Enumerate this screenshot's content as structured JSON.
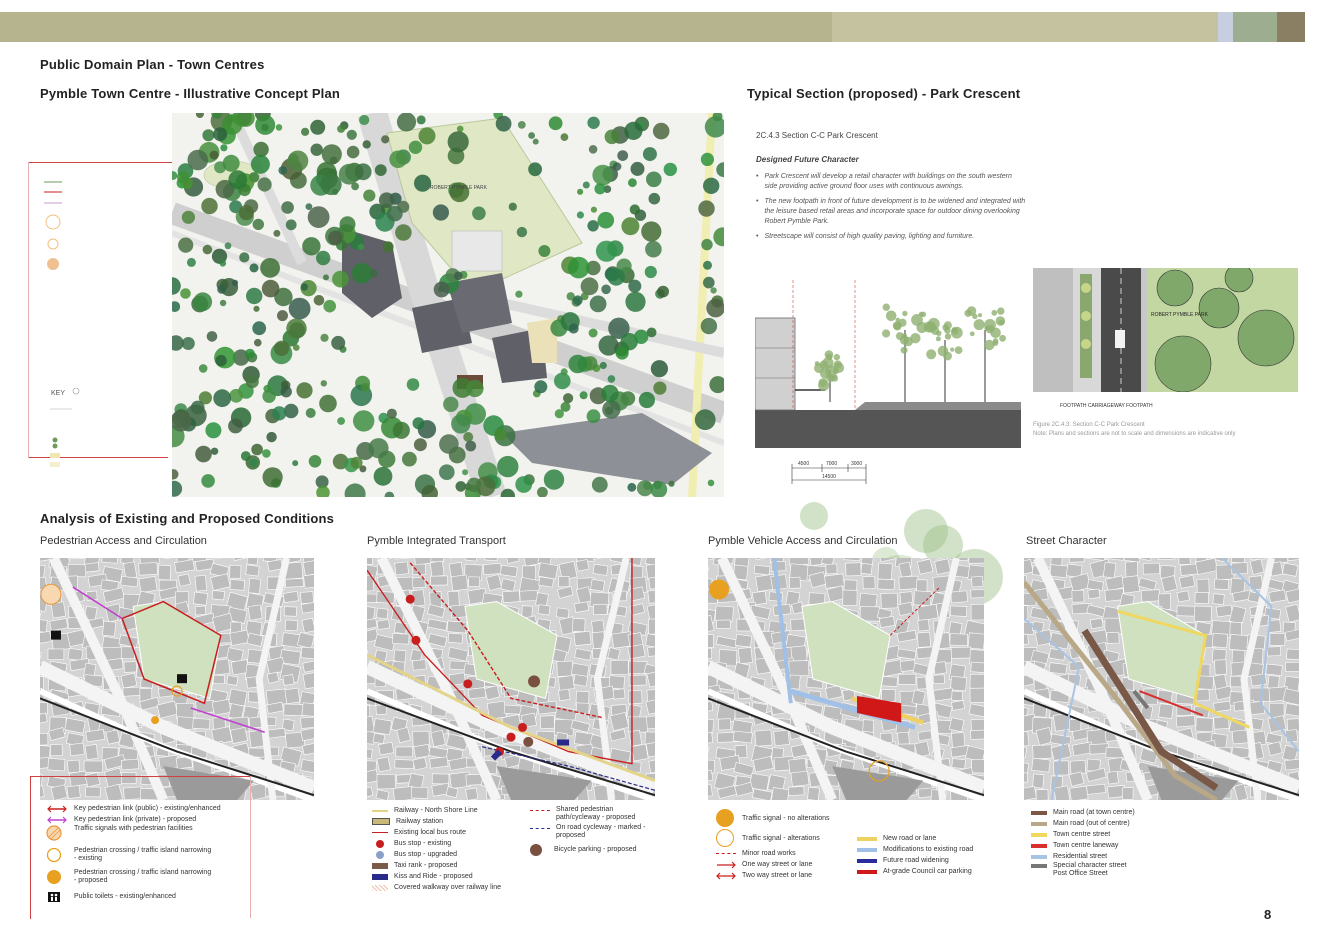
{
  "page": {
    "title": "Public Domain Plan - Town Centres",
    "page_number": "8",
    "colors": {
      "band_main": "#b5b48f",
      "band_light": "#c7cedf",
      "band_sage": "#9cae8f",
      "band_dark": "#8a7e63",
      "green": "#6e9a5a",
      "red": "#c81e1e"
    }
  },
  "concept_plan": {
    "title": "Pymble Town Centre - Illustrative Concept Plan",
    "park_label": "ROBERT PYMBLE PARK",
    "key_label": "KEY"
  },
  "section": {
    "title": "Typical Section (proposed) - Park Crescent",
    "heading": "2C.4.3 Section C-C Park Crescent",
    "subheading": "Designed Future Character",
    "bullets": [
      "Park Crescent will develop a retail character with buildings on the south western side providing active ground floor uses with continuous awnings.",
      "The new footpath in front of future development is to be widened and integrated with the leisure based retail areas and incorporate space for outdoor dining overlooking Robert Pymble Park.",
      "Streetscape will consist of high quality paving, lighting and furniture."
    ],
    "dims": [
      "4500",
      "7000",
      "3000"
    ],
    "total_dim": "14500",
    "plan_park_label": "ROBERT PYMBLE PARK",
    "plan_bottom_label": "FOOTPATH   CARRIAGEWAY   FOOTPATH",
    "figure_caption": "Figure 2C.4.3: Section C-C Park Crescent",
    "figure_note": "Note: Plans and sections are not to scale and dimensions are indicative only"
  },
  "analysis": {
    "title": "Analysis of Existing and Proposed Conditions",
    "panels": [
      {
        "title": "Pedestrian Access and Circulation"
      },
      {
        "title": "Pymble Integrated Transport"
      },
      {
        "title": "Pymble Vehicle Access and Circulation"
      },
      {
        "title": "Street Character"
      }
    ]
  },
  "legend_pedestrian": [
    {
      "label": "Key pedestrian link (public) - existing/enhanced",
      "color": "#c81e1e",
      "type": "arrow"
    },
    {
      "label": "Key pedestrian link (private) - proposed",
      "color": "#c040d0",
      "type": "arrow"
    },
    {
      "label": "Traffic signals with pedestrian facilities",
      "color": "#e8963c",
      "type": "hatch-circle"
    },
    {
      "label": "Pedestrian crossing / traffic island narrowing - existing",
      "color": "#e8a020",
      "type": "ring"
    },
    {
      "label": "Pedestrian crossing / traffic island narrowing - proposed",
      "color": "#e8a020",
      "type": "disc"
    },
    {
      "label": "Public toilets - existing/enhanced",
      "color": "#111111",
      "type": "toilet"
    }
  ],
  "legend_transport_a": [
    {
      "label": "Railway - North Shore Line",
      "color": "#e4d48a",
      "type": "line"
    },
    {
      "label": "Railway station",
      "color": "#c9b976",
      "type": "box"
    },
    {
      "label": "Existing local bus route",
      "color": "#c81e1e",
      "type": "line"
    },
    {
      "label": "Bus stop - existing",
      "color": "#c81e1e",
      "type": "dot"
    },
    {
      "label": "Bus stop - upgraded",
      "color": "#8aa0c8",
      "type": "dot"
    },
    {
      "label": "Taxi rank - proposed",
      "color": "#7a5a48",
      "type": "box"
    },
    {
      "label": "Kiss and Ride - proposed",
      "color": "#2a2a8a",
      "type": "box"
    },
    {
      "label": "Covered walkway over railway line",
      "color": "#f0c0b0",
      "type": "hatch"
    }
  ],
  "legend_transport_b": [
    {
      "label": "Shared pedestrian path/cycleway - proposed",
      "color": "#c81e1e",
      "type": "dash"
    },
    {
      "label": "On road cycleway - marked - proposed",
      "color": "#2a2a8a",
      "type": "dash"
    },
    {
      "label": "Bicycle parking - proposed",
      "color": "#7a5040",
      "type": "bigdot"
    }
  ],
  "legend_vehicle_a": [
    {
      "label": "Traffic signal - no alterations",
      "color": "#e8a020",
      "type": "disc"
    },
    {
      "label": "Traffic signal - alterations",
      "color": "#e8a020",
      "type": "ring"
    },
    {
      "label": "Minor road works",
      "color": "#c81e1e",
      "type": "dash"
    },
    {
      "label": "One way street or lane",
      "color": "#c81e1e",
      "type": "arrow"
    },
    {
      "label": "Two way street or lane",
      "color": "#c81e1e",
      "type": "arrow2"
    }
  ],
  "legend_vehicle_b": [
    {
      "label": "New road or lane",
      "color": "#f0d060",
      "type": "line"
    },
    {
      "label": "Modifications to existing road",
      "color": "#a0c0e8",
      "type": "line"
    },
    {
      "label": "Future road widening",
      "color": "#2a2a9a",
      "type": "line"
    },
    {
      "label": "At-grade Council car parking",
      "color": "#d01818",
      "type": "line"
    }
  ],
  "legend_street": [
    {
      "label": "Main road (at town centre)",
      "color": "#7a5848"
    },
    {
      "label": "Main road (out of centre)",
      "color": "#b8a888"
    },
    {
      "label": "Town centre street",
      "color": "#f0d860"
    },
    {
      "label": "Town centre laneway",
      "color": "#d83030"
    },
    {
      "label": "Residential street",
      "color": "#a8c4e4"
    },
    {
      "label": "Special character street Post Office Street",
      "color": "#777777"
    }
  ]
}
